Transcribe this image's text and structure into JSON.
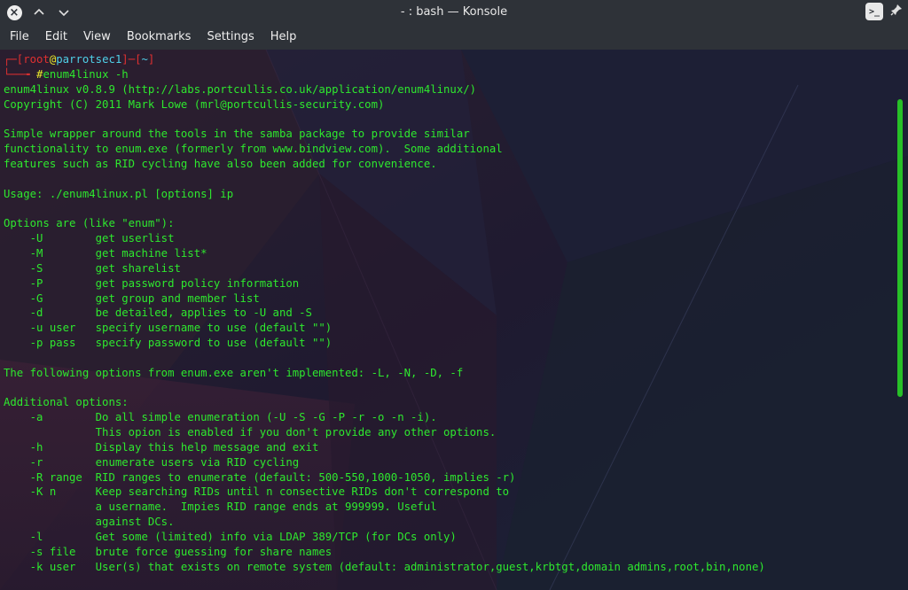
{
  "window": {
    "title": "- : bash — Konsole",
    "icons": [
      "close-icon",
      "chevron-up-icon",
      "chevron-down-icon",
      "terminal-icon",
      "pin-icon"
    ]
  },
  "menu": [
    "File",
    "Edit",
    "View",
    "Bookmarks",
    "Settings",
    "Help"
  ],
  "prompt": {
    "open": "┌─[",
    "user": "root",
    "at": "@",
    "host": "parrotsec1",
    "mid": "]─[",
    "dir": "~",
    "close": "]",
    "line2": "└──╼ ",
    "hash": "#",
    "command": "enum4linux -h"
  },
  "output": [
    "enum4linux v0.8.9 (http://labs.portcullis.co.uk/application/enum4linux/)",
    "Copyright (C) 2011 Mark Lowe (mrl@portcullis-security.com)",
    "",
    "Simple wrapper around the tools in the samba package to provide similar",
    "functionality to enum.exe (formerly from www.bindview.com).  Some additional",
    "features such as RID cycling have also been added for convenience.",
    "",
    "Usage: ./enum4linux.pl [options] ip",
    "",
    "Options are (like \"enum\"):",
    "    -U        get userlist",
    "    -M        get machine list*",
    "    -S        get sharelist",
    "    -P        get password policy information",
    "    -G        get group and member list",
    "    -d        be detailed, applies to -U and -S",
    "    -u user   specify username to use (default \"\")",
    "    -p pass   specify password to use (default \"\")",
    "",
    "The following options from enum.exe aren't implemented: -L, -N, -D, -f",
    "",
    "Additional options:",
    "    -a        Do all simple enumeration (-U -S -G -P -r -o -n -i).",
    "              This opion is enabled if you don't provide any other options.",
    "    -h        Display this help message and exit",
    "    -r        enumerate users via RID cycling",
    "    -R range  RID ranges to enumerate (default: 500-550,1000-1050, implies -r)",
    "    -K n      Keep searching RIDs until n consective RIDs don't correspond to",
    "              a username.  Impies RID range ends at 999999. Useful",
    "              against DCs.",
    "    -l        Get some (limited) info via LDAP 389/TCP (for DCs only)",
    "    -s file   brute force guessing for share names",
    "    -k user   User(s) that exists on remote system (default: administrator,guest,krbtgt,domain admins,root,bin,none)"
  ],
  "colors": {
    "terminal_text": "#2ee82e",
    "prompt_red": "#e03030",
    "prompt_yellow": "#e8e82a",
    "prompt_cyan": "#4fd0e8",
    "titlebar": "#2e3238"
  }
}
